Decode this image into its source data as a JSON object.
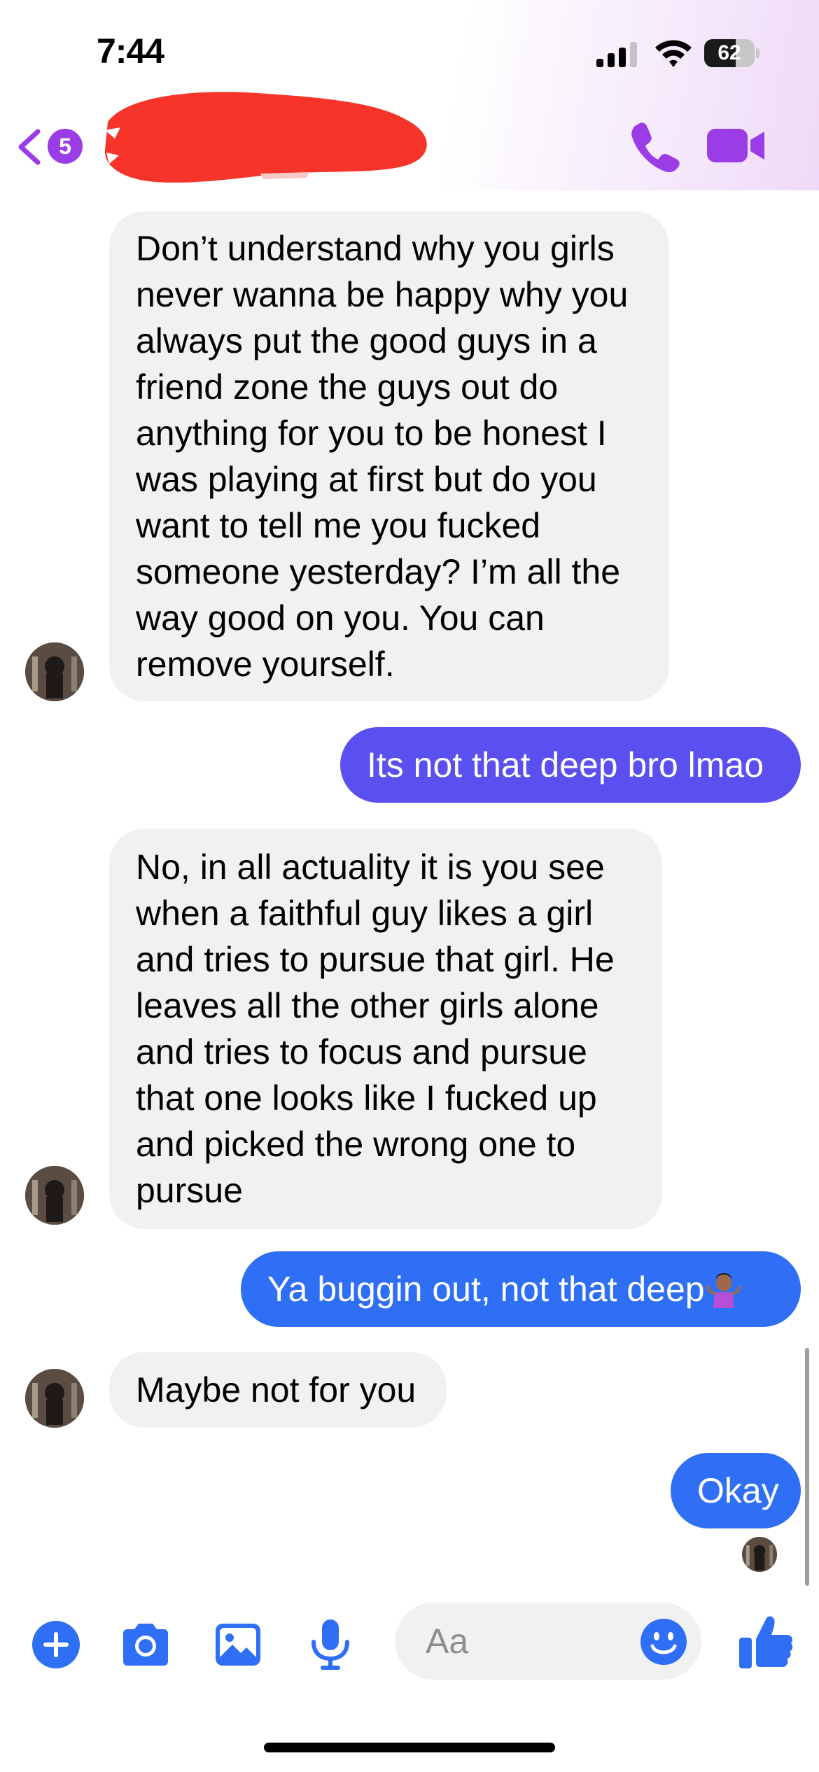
{
  "status_bar": {
    "time": "7:44",
    "battery_level": "62",
    "battery_fraction": 0.62
  },
  "header": {
    "back_badge_count": "5",
    "accent_color": "#9b3de6"
  },
  "messages": [
    {
      "direction": "incoming",
      "lines": [
        "Don’t understand why you girls",
        "never wanna be happy why you",
        "always put the good guys in a",
        "friend zone the guys out do",
        "anything for you to be honest I",
        "was playing at first but do you",
        "want to tell me you fucked",
        "someone yesterday? I’m all the",
        "way good on you. You can",
        "remove yourself."
      ]
    },
    {
      "direction": "outgoing",
      "text": "Its not that deep bro lmao",
      "color": "#5a4fef"
    },
    {
      "direction": "incoming",
      "lines": [
        "No, in all actuality it is you see",
        "when a faithful guy likes a girl",
        "and tries to pursue that girl. He",
        "leaves all the other girls alone",
        "and tries to focus and pursue",
        "that one looks like I fucked up",
        "and picked the wrong one to",
        "pursue"
      ]
    },
    {
      "direction": "outgoing",
      "text": "Ya buggin out,  not that deep",
      "emoji": "person-shrugging-emoji",
      "color": "#2f6ff5"
    },
    {
      "direction": "incoming",
      "lines": [
        "Maybe not for you"
      ]
    },
    {
      "direction": "outgoing",
      "text": "Okay",
      "color": "#2f6ff5"
    }
  ],
  "composer": {
    "placeholder": "Aa",
    "icons": [
      "plus-icon",
      "camera-icon",
      "gallery-icon",
      "microphone-icon",
      "emoji-icon",
      "thumbs-up-icon"
    ],
    "icon_color": "#2f6ff5"
  }
}
